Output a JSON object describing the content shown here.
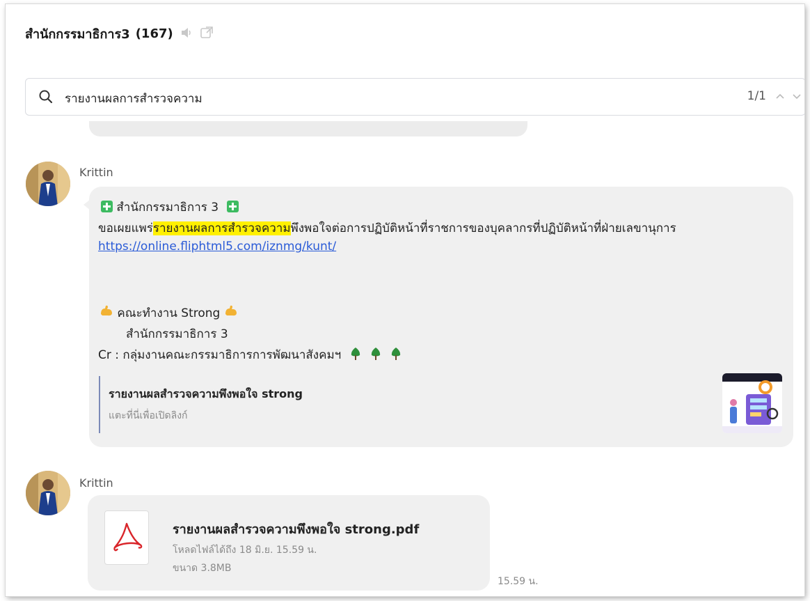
{
  "chat": {
    "title": "สำนักกรรมาธิการ3",
    "member_count": "(167)"
  },
  "search": {
    "query": "รายงานผลการสำรวจความ",
    "result_counter": "1/1"
  },
  "messages": [
    {
      "sender": "Krittin",
      "line1_text": "สำนักกรรมาธิการ 3",
      "line2_prefix": "ขอเผยแพร่",
      "line2_highlight": "รายงานผลการสำรวจความ",
      "line2_suffix": "พึงพอใจต่อการปฏิบัติหน้าที่ราชการของบุคลากรที่ปฏิบัติหน้าที่ฝ่ายเลขานุการ",
      "link": "https://online.fliphtml5.com/iznmg/kunt/",
      "team_line": "คณะทำงาน Strong",
      "office_line": "สำนักกรรมาธิการ 3",
      "credit_line": "Cr : กลุ่มงานคณะกรรมาธิการการพัฒนาสังคมฯ",
      "link_preview": {
        "title": "รายงานผลสำรวจความพึงพอใจ strong",
        "subtitle": "แตะที่นี่เพื่อเปิดลิงก์"
      }
    },
    {
      "sender": "Krittin",
      "file": {
        "name": "รายงานผลสำรวจความพึงพอใจ strong.pdf",
        "expiry": "โหลดไฟล์ได้ถึง 18 มิ.ย. 15.59 น.",
        "size": "ขนาด 3.8MB"
      },
      "time": "15.59 น."
    }
  ],
  "colors": {
    "highlight": "#fff000",
    "link": "#2a5bd7",
    "bubble": "#f0f0f0",
    "pdf_red": "#d9252a"
  }
}
